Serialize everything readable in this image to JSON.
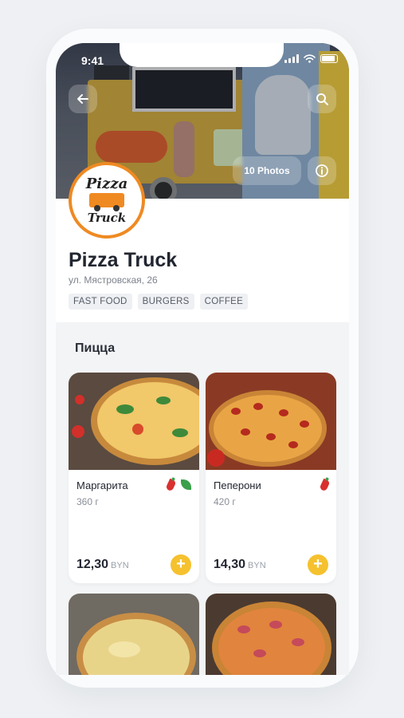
{
  "status": {
    "time": "9:41"
  },
  "header": {
    "photos_label": "10 Photos"
  },
  "logo": {
    "line1": "Pizza",
    "line2": "Truck"
  },
  "restaurant": {
    "name": "Pizza Truck",
    "address": "ул. Мястровская, 26",
    "tags": [
      "FAST FOOD",
      "BURGERS",
      "COFFEE"
    ]
  },
  "menu": {
    "section_title": "Пицца",
    "items": [
      {
        "name": "Маргарита",
        "weight": "360 г",
        "price": "12,30",
        "currency": "BYN",
        "badges": [
          "spicy",
          "vegetarian"
        ]
      },
      {
        "name": "Пеперони",
        "weight": "420 г",
        "price": "14,30",
        "currency": "BYN",
        "badges": [
          "spicy"
        ]
      },
      {
        "name": "",
        "weight": "",
        "price": "",
        "currency": ""
      },
      {
        "name": "",
        "weight": "",
        "price": "",
        "currency": ""
      }
    ]
  },
  "colors": {
    "accent": "#f5c12e",
    "logo_ring": "#ef8a22",
    "spicy": "#d9302f",
    "vegetarian": "#3aa04a"
  },
  "icons": [
    "back-arrow-icon",
    "search-icon",
    "info-icon",
    "chili-icon",
    "leaf-icon",
    "plus-icon"
  ]
}
